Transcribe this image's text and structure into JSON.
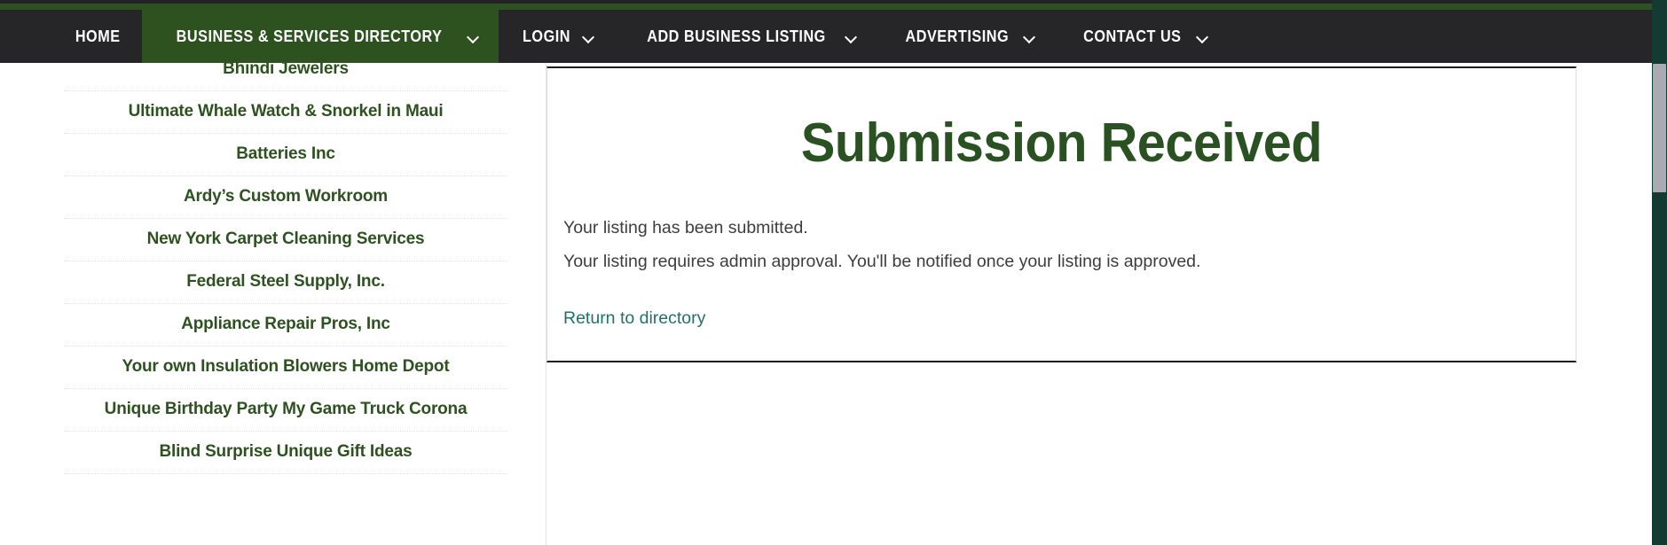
{
  "nav": {
    "items": [
      {
        "label": "HOME",
        "has_caret": false,
        "active": false,
        "name": "home"
      },
      {
        "label": "BUSINESS & SERVICES DIRECTORY",
        "has_caret": true,
        "active": true,
        "name": "business-services-directory"
      },
      {
        "label": "LOGIN",
        "has_caret": true,
        "active": false,
        "name": "login"
      },
      {
        "label": "ADD BUSINESS LISTING",
        "has_caret": true,
        "active": false,
        "name": "add-business-listing"
      },
      {
        "label": "ADVERTISING",
        "has_caret": true,
        "active": false,
        "name": "advertising"
      },
      {
        "label": "CONTACT US",
        "has_caret": true,
        "active": false,
        "name": "contact-us"
      }
    ],
    "accent_color": "#2d5220",
    "bar_color": "#262629"
  },
  "sidebar": {
    "items": [
      {
        "label": "Bhindi Jewelers"
      },
      {
        "label": "Ultimate Whale Watch & Snorkel in Maui"
      },
      {
        "label": "Batteries Inc"
      },
      {
        "label": "Ardy’s Custom Workroom"
      },
      {
        "label": "New York Carpet Cleaning Services"
      },
      {
        "label": "Federal Steel Supply, Inc."
      },
      {
        "label": "Appliance Repair Pros, Inc"
      },
      {
        "label": "Your own Insulation Blowers Home Depot"
      },
      {
        "label": "Unique Birthday Party My Game Truck Corona"
      },
      {
        "label": "Blind Surprise Unique Gift Ideas"
      }
    ],
    "link_color": "#2d5220"
  },
  "main": {
    "title": "Submission Received",
    "paragraph_1": "Your listing has been submitted.",
    "paragraph_2": "Your listing requires admin approval. You'll be notified once your listing is approved.",
    "return_link": "Return to directory",
    "title_color": "#2a5122",
    "link_color": "#22706d"
  },
  "scrollbar": {
    "track_color": "#133a33",
    "thumb_color": "#a9aab3"
  }
}
